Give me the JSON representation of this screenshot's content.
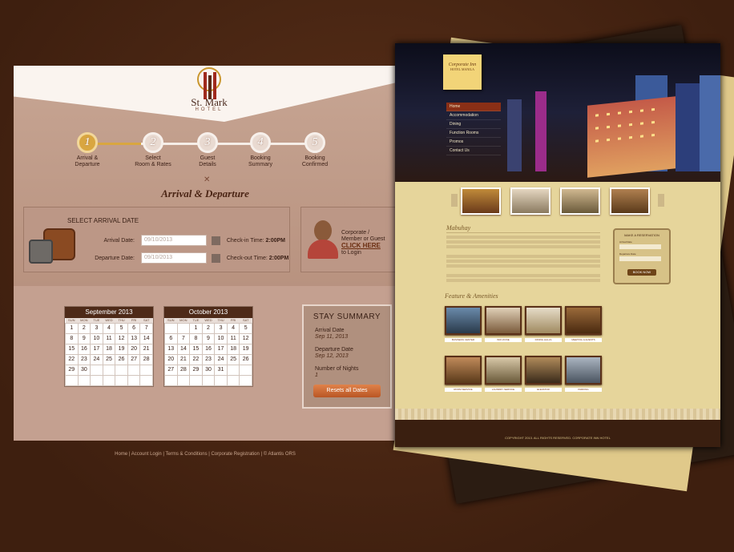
{
  "hotel": {
    "name": "St. Mark",
    "subname": "HOTEL"
  },
  "steps": [
    {
      "num": "1",
      "label1": "Arrival &",
      "label2": "Departure"
    },
    {
      "num": "2",
      "label1": "Select",
      "label2": "Room & Rates"
    },
    {
      "num": "3",
      "label1": "Guest",
      "label2": "Details"
    },
    {
      "num": "4",
      "label1": "Booking",
      "label2": "Summary"
    },
    {
      "num": "5",
      "label1": "Booking",
      "label2": "Confirmed"
    }
  ],
  "section_title": "Arrival & Departure",
  "arrival": {
    "heading": "SELECT ARRIVAL DATE",
    "arrival_label": "Arrival Date:",
    "arrival_value": "09/10/2013",
    "departure_label": "Departure Date:",
    "departure_value": "09/10/2013",
    "checkin_label": "Check-in Time:",
    "checkin_value": "2:00PM",
    "checkout_label": "Check-out Time:",
    "checkout_value": "2:00PM"
  },
  "corporate": {
    "line1": "Corporate /",
    "line2": "Member or Guest",
    "link": "CLICK HERE",
    "line3": "to Login"
  },
  "calendars": [
    {
      "month": "September 2013",
      "days": [
        "SUN",
        "MON",
        "TUE",
        "WED",
        "THU",
        "FRI",
        "SAT"
      ],
      "weeks": [
        [
          "1",
          "2",
          "3",
          "4",
          "5",
          "6",
          "7"
        ],
        [
          "8",
          "9",
          "10",
          "11",
          "12",
          "13",
          "14"
        ],
        [
          "15",
          "16",
          "17",
          "18",
          "19",
          "20",
          "21"
        ],
        [
          "22",
          "23",
          "24",
          "25",
          "26",
          "27",
          "28"
        ],
        [
          "29",
          "30",
          "",
          "",
          "",
          "",
          ""
        ],
        [
          "",
          "",
          "",
          "",
          "",
          "",
          ""
        ]
      ]
    },
    {
      "month": "October 2013",
      "days": [
        "SUN",
        "MON",
        "TUE",
        "WED",
        "THU",
        "FRI",
        "SAT"
      ],
      "weeks": [
        [
          "",
          "",
          "1",
          "2",
          "3",
          "4",
          "5"
        ],
        [
          "6",
          "7",
          "8",
          "9",
          "10",
          "11",
          "12"
        ],
        [
          "13",
          "14",
          "15",
          "16",
          "17",
          "18",
          "19"
        ],
        [
          "20",
          "21",
          "22",
          "23",
          "24",
          "25",
          "26"
        ],
        [
          "27",
          "28",
          "29",
          "30",
          "31",
          "",
          ""
        ],
        [
          "",
          "",
          "",
          "",
          "",
          "",
          ""
        ]
      ]
    }
  ],
  "summary": {
    "title": "STAY SUMMARY",
    "arrival_label": "Arrival Date",
    "arrival_value": "Sep 11, 2013",
    "departure_label": "Departure Date",
    "departure_value": "Sep 12, 2013",
    "nights_label": "Number of Nights",
    "nights_value": "1",
    "reset_button": "Resets all Dates"
  },
  "footer": "Home | Account Login | Terms & Conditions | Corporate Registration | © Atlantis ORS",
  "right": {
    "brand": "Corporate Inn",
    "brand_sub": "HOTEL MANILA",
    "nav": [
      "Home",
      "Accommodation",
      "Dining",
      "Function Rooms",
      "Promos",
      "Contact Us"
    ],
    "welcome_title": "Mabuhay",
    "feature_title": "Feature & Amenities",
    "reservation_title": "MAKE A RESERVATION",
    "arrival_label": "Arrival Date",
    "departure_label": "Departure Date",
    "book_button": "BOOK NOW",
    "features": [
      "BUSINESS CENTER",
      "WIFI ZONE",
      "DINING HALLS",
      "MEETING & EVENTS",
      "ROOM SERVICE",
      "LAUNDRY SERVICE",
      "ELEVATOR",
      "PARKING"
    ],
    "copyright": "COPYRIGHT 2013. ALL RIGHTS RESERVED. CORPORATE INN HOTEL"
  }
}
